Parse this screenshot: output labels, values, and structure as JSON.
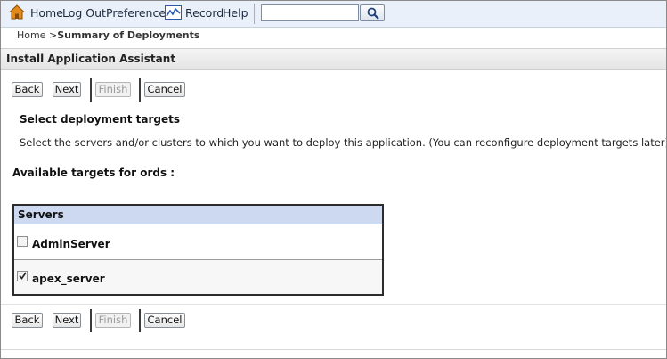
{
  "toolbar": {
    "home": "Home",
    "logout": "Log Out",
    "preferences": "Preferences",
    "record": "Record",
    "help": "Help",
    "search_value": "",
    "icons": {
      "home": "home-icon",
      "record": "record-icon",
      "search": "search-icon"
    }
  },
  "breadcrumb": {
    "home": "Home >",
    "current": "Summary of Deployments"
  },
  "section": {
    "title": "Install Application Assistant"
  },
  "buttons": {
    "back": "Back",
    "next": "Next",
    "finish": "Finish",
    "cancel": "Cancel"
  },
  "content": {
    "heading": "Select deployment targets",
    "description": "Select the servers and/or clusters to which you want to deploy this application. (You can reconfigure deployment targets later).",
    "available": "Available targets for ords :"
  },
  "servers_table": {
    "header": "Servers",
    "rows": [
      {
        "name": "AdminServer",
        "checked": false
      },
      {
        "name": "apex_server",
        "checked": true
      }
    ]
  },
  "colors": {
    "toolbar_bg": "#e9f0fa",
    "table_header_bg": "#ccd9f0",
    "section_header_bg": "#e4e4e4"
  }
}
